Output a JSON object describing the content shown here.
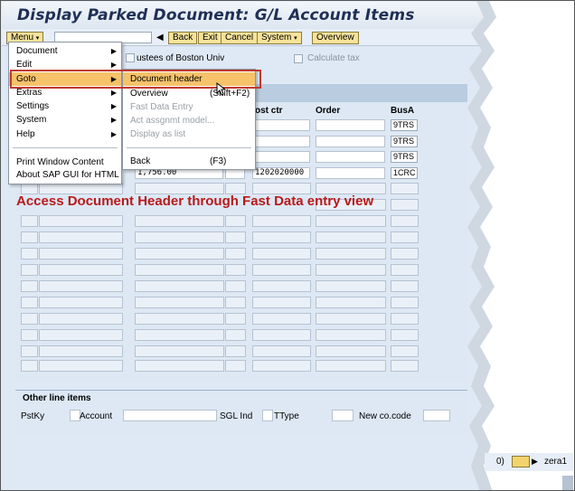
{
  "window": {
    "title": "Display Parked Document: G/L Account Items"
  },
  "toolbar": {
    "menu_label": "Menu",
    "back_label": "Back",
    "exit_label": "Exit",
    "cancel_label": "Cancel",
    "system_label": "System",
    "overview_label": "Overview",
    "command_value": ""
  },
  "header_fields": {
    "company_text": "ustees of Boston Univ",
    "calculate_tax_label": "Calculate tax"
  },
  "grid": {
    "columns": [
      "ost ctr",
      "Order",
      "BusA"
    ],
    "rows": [
      {
        "amount": "",
        "cost_ctr": "",
        "order": "",
        "busa": "9TRS"
      },
      {
        "amount": "",
        "cost_ctr": "",
        "order": "",
        "busa": "9TRS"
      },
      {
        "amount": "",
        "cost_ctr": "",
        "order": "",
        "busa": "9TRS"
      },
      {
        "amount": "1,756.00",
        "cost_ctr": "1202020000",
        "order": "",
        "busa": "1CRC"
      }
    ]
  },
  "other_line_items": {
    "title": "Other line items",
    "pstky_label": "PstKy",
    "account_label": "Account",
    "sgl_ind_label": "SGL Ind",
    "ttype_label": "TType",
    "new_cocode_label": "New co.code"
  },
  "main_menu": {
    "items": [
      {
        "label": "Document",
        "has_sub": true
      },
      {
        "label": "Edit",
        "has_sub": true
      },
      {
        "label": "Goto",
        "has_sub": true
      },
      {
        "label": "Extras",
        "has_sub": true
      },
      {
        "label": "Settings",
        "has_sub": true
      },
      {
        "label": "System",
        "has_sub": true
      },
      {
        "label": "Help",
        "has_sub": true
      },
      {
        "label": "Print Window Content",
        "has_sub": false
      },
      {
        "label": "About SAP GUI for HTML",
        "has_sub": false
      }
    ]
  },
  "goto_menu": {
    "items": [
      {
        "label": "Document header",
        "shortcut": "",
        "disabled": false
      },
      {
        "label": "Overview",
        "shortcut": "(Shift+F2)",
        "disabled": false
      },
      {
        "label": "Fast Data Entry",
        "shortcut": "",
        "disabled": true
      },
      {
        "label": "Act assgnmt model...",
        "shortcut": "",
        "disabled": true
      },
      {
        "label": "Display as list",
        "shortcut": "",
        "disabled": true
      },
      {
        "label": "Back",
        "shortcut": "(F3)",
        "disabled": false
      }
    ]
  },
  "annotation": {
    "text": "Access Document Header through Fast Data entry view"
  },
  "status_bar": {
    "fragment": "0)",
    "system": "zera1"
  },
  "colors": {
    "title": "#1f2f55",
    "button": "#f6e39a",
    "highlight": "#f6c26a",
    "annotation": "#b81a1a",
    "callout_border": "#c0392b"
  }
}
